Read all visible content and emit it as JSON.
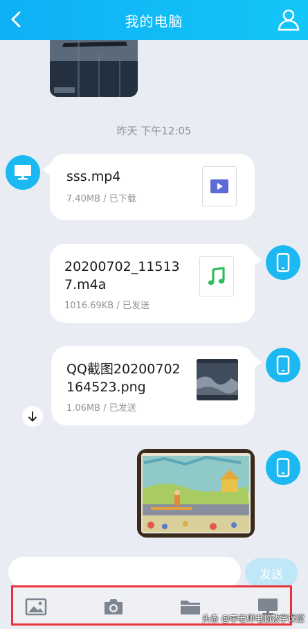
{
  "header": {
    "title": "我的电脑",
    "back_icon": "chevron-left-icon",
    "user_icon": "user-icon",
    "color": "#12bdf6"
  },
  "timestamp": "昨天 下午12:05",
  "messages": [
    {
      "direction": "received",
      "avatar_icon": "computer-icon",
      "file_name": "sss.mp4",
      "meta": "7.40MB / 已下载",
      "file_icon": "video-play-icon"
    },
    {
      "direction": "sent",
      "avatar_icon": "phone-icon",
      "file_name": "20200702_115137.m4a",
      "file_name_lines": [
        "20200702_11513",
        "7.m4a"
      ],
      "meta": "1016.69KB / 已发送",
      "file_icon": "music-note-icon"
    },
    {
      "direction": "sent",
      "avatar_icon": "phone-icon",
      "file_name": "QQ截图20200702164523.png",
      "file_name_lines": [
        "QQ截图20200702",
        "164523.png"
      ],
      "meta": "1.06MB / 已发送",
      "file_icon": "image-thumbnail"
    },
    {
      "direction": "sent",
      "avatar_icon": "phone-icon",
      "type": "photo"
    }
  ],
  "input": {
    "placeholder": "",
    "value": ""
  },
  "send_button": "发送",
  "toolbar": [
    {
      "icon": "image-icon"
    },
    {
      "icon": "camera-icon"
    },
    {
      "icon": "folder-icon"
    },
    {
      "icon": "computer-icon"
    }
  ],
  "watermark": "头条 @李老师电脑教学课堂",
  "colors": {
    "accent": "#12bdf6",
    "send_disabled": "#bfe7f8",
    "highlight_border": "#e8333a",
    "background": "#e9edf3"
  }
}
